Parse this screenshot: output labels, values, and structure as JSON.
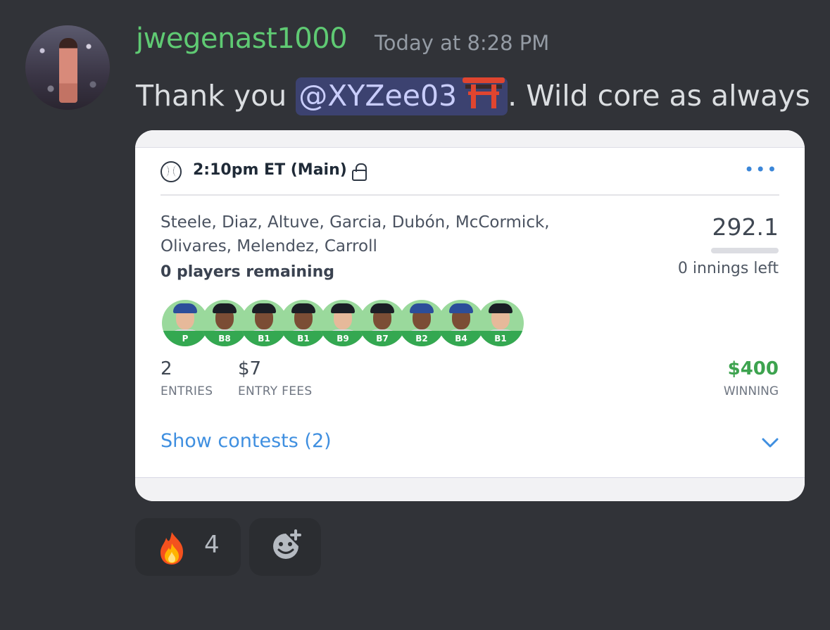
{
  "message": {
    "author": "jwegenast1000",
    "timestamp": "Today at 8:28 PM",
    "text_before": "Thank you ",
    "mention": "@XYZee03",
    "mention_emoji": "torii-gate-icon",
    "text_after": ". Wild core as always"
  },
  "card": {
    "slate_title": "2:10pm ET (Main)",
    "menu_label": "•••",
    "lineup_players": "Steele, Diaz, Altuve, Garcia, Dubón, McCormick, Olivares, Melendez, Carroll",
    "players_remaining": "0 players remaining",
    "score": "292.1",
    "innings_left": "0 innings left",
    "positions": [
      "P",
      "B8",
      "B1",
      "B1",
      "B9",
      "B7",
      "B2",
      "B4",
      "B1"
    ],
    "entries_value": "2",
    "entries_label": "ENTRIES",
    "fees_value": "$7",
    "fees_label": "ENTRY FEES",
    "winning_value": "$400",
    "winning_label": "WINNING",
    "show_contests": "Show contests (2)"
  },
  "reactions": {
    "fire_count": "4",
    "fire_icon": "fire-icon",
    "add_icon": "add-reaction-icon"
  },
  "colors": {
    "username": "#5fca73",
    "mention_bg": "#3c4270",
    "winning": "#3da34f",
    "link": "#3f8fe0"
  }
}
